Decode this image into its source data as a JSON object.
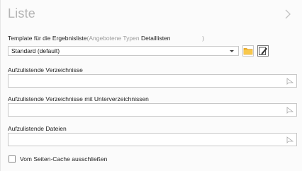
{
  "panel": {
    "title": "Liste"
  },
  "template": {
    "label": "Template für die Ergebnisliste",
    "hint_prefix": "(Angebotene Typen",
    "hint_value": "Detaillisten",
    "hint_suffix": ")",
    "selected": "Standard (default)"
  },
  "fields": [
    {
      "label": "Aufzulistende Verzeichnisse",
      "value": ""
    },
    {
      "label": "Aufzulistende Verzeichnisse mit Unterverzeichnissen",
      "value": ""
    },
    {
      "label": "Aufzulistende Dateien",
      "value": ""
    }
  ],
  "cache": {
    "label": "Vom Seiten-Cache ausschließen",
    "checked": false
  },
  "icons": {
    "collapse": "chevron-right-icon",
    "folder": "folder-icon",
    "edit": "edit-icon",
    "picker": "link-picker-icon"
  },
  "colors": {
    "folder": "#f5b731",
    "title": "#b4b4b4",
    "hint": "#9a9a9a"
  }
}
